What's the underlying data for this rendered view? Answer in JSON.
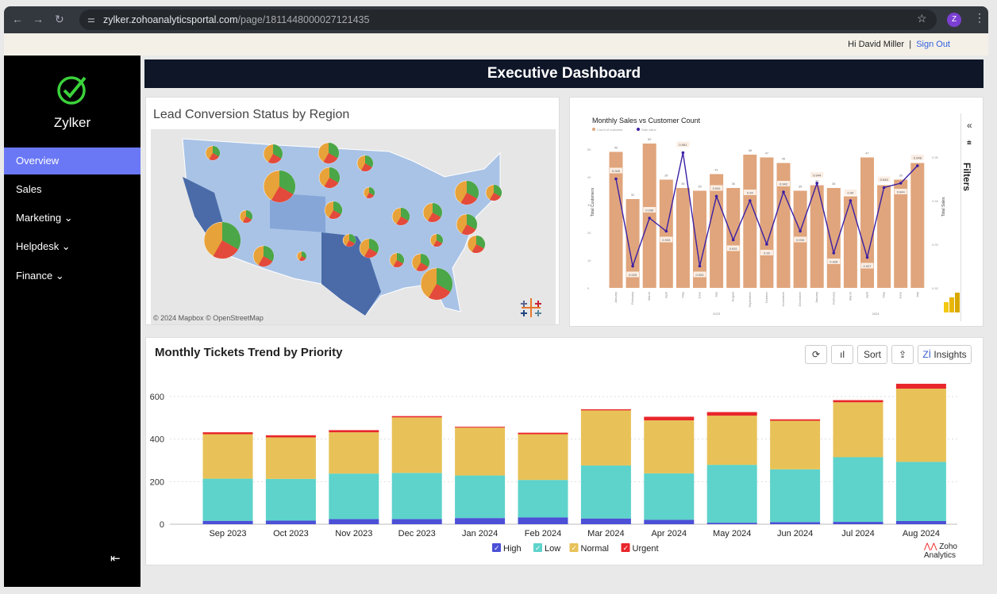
{
  "browser": {
    "url_host": "zylker.zohoanalyticsportal.com",
    "url_path": "/page/1811448000027121435",
    "profile_initial": "Z"
  },
  "topbar": {
    "greeting": "Hi David Miller",
    "separator": "|",
    "sign_out": "Sign Out"
  },
  "sidebar": {
    "brand": "Zylker",
    "items": [
      {
        "label": "Overview",
        "active": true
      },
      {
        "label": "Sales"
      },
      {
        "label": "Marketing ⌄"
      },
      {
        "label": "Helpdesk ⌄"
      },
      {
        "label": "Finance ⌄"
      }
    ]
  },
  "dashboard": {
    "title": "Executive Dashboard"
  },
  "map": {
    "title": "Lead Conversion Status by Region",
    "credit": "© 2024 Mapbox © OpenStreetMap"
  },
  "sales_panel": {
    "filters_label": "Filters"
  },
  "tickets": {
    "title": "Monthly Tickets Trend by Priority",
    "buttons": {
      "sort": "Sort",
      "insights": "Insights"
    },
    "branding": "Zoho Analytics"
  },
  "chart_data": [
    {
      "type": "bar+line",
      "title": "Monthly Sales vs Customer Count",
      "legend": [
        "Count of customer",
        "Sale value"
      ],
      "ylabel": "Total Customers",
      "y2label": "Total Sales",
      "ylim": [
        0,
        50
      ],
      "y2lim": [
        0.92,
        0.95
      ],
      "categories": [
        "January",
        "February",
        "March",
        "April",
        "May",
        "June",
        "July",
        "August",
        "September",
        "October",
        "November",
        "December",
        "January",
        "February",
        "March",
        "April",
        "May",
        "June",
        "July"
      ],
      "year_groups": [
        "2023",
        "2024"
      ],
      "series": [
        {
          "name": "Count of customer",
          "type": "bar",
          "color": "#e0a57c",
          "values": [
            49,
            32,
            52,
            39,
            36,
            35,
            41,
            36,
            48,
            47,
            45,
            35,
            37,
            36,
            33,
            47,
            37,
            39,
            45
          ]
        },
        {
          "name": "Sale value",
          "type": "line",
          "color": "#3b1fa3",
          "values": [
            0.945,
            0.925,
            0.936,
            0.933,
            0.951,
            0.925,
            0.941,
            0.931,
            0.94,
            0.93,
            0.942,
            0.933,
            0.944,
            0.928,
            0.94,
            0.927,
            0.943,
            0.944,
            0.948
          ]
        }
      ]
    },
    {
      "type": "stacked-bar",
      "title": "Monthly Tickets Trend by Priority",
      "ylim": [
        0,
        650
      ],
      "yticks": [
        0,
        200,
        400,
        600
      ],
      "grid": true,
      "legend_position": "bottom",
      "categories": [
        "Sep 2023",
        "Oct 2023",
        "Nov 2023",
        "Dec 2023",
        "Jan 2024",
        "Feb 2024",
        "Mar 2024",
        "Apr 2024",
        "May 2024",
        "Jun 2024",
        "Jul 2024",
        "Aug 2024"
      ],
      "series": [
        {
          "name": "High",
          "color": "#4b50d6",
          "values": [
            16,
            17,
            24,
            24,
            29,
            32,
            27,
            21,
            7,
            10,
            11,
            15
          ]
        },
        {
          "name": "Low",
          "color": "#5dd3cb",
          "values": [
            198,
            196,
            214,
            217,
            200,
            176,
            249,
            218,
            272,
            248,
            304,
            278
          ]
        },
        {
          "name": "Normal",
          "color": "#e8c258",
          "values": [
            209,
            195,
            194,
            261,
            225,
            215,
            259,
            249,
            231,
            228,
            258,
            344
          ]
        },
        {
          "name": "Urgent",
          "color": "#e8262b",
          "values": [
            9,
            10,
            10,
            6,
            4,
            7,
            5,
            17,
            17,
            7,
            10,
            23
          ]
        }
      ]
    }
  ]
}
